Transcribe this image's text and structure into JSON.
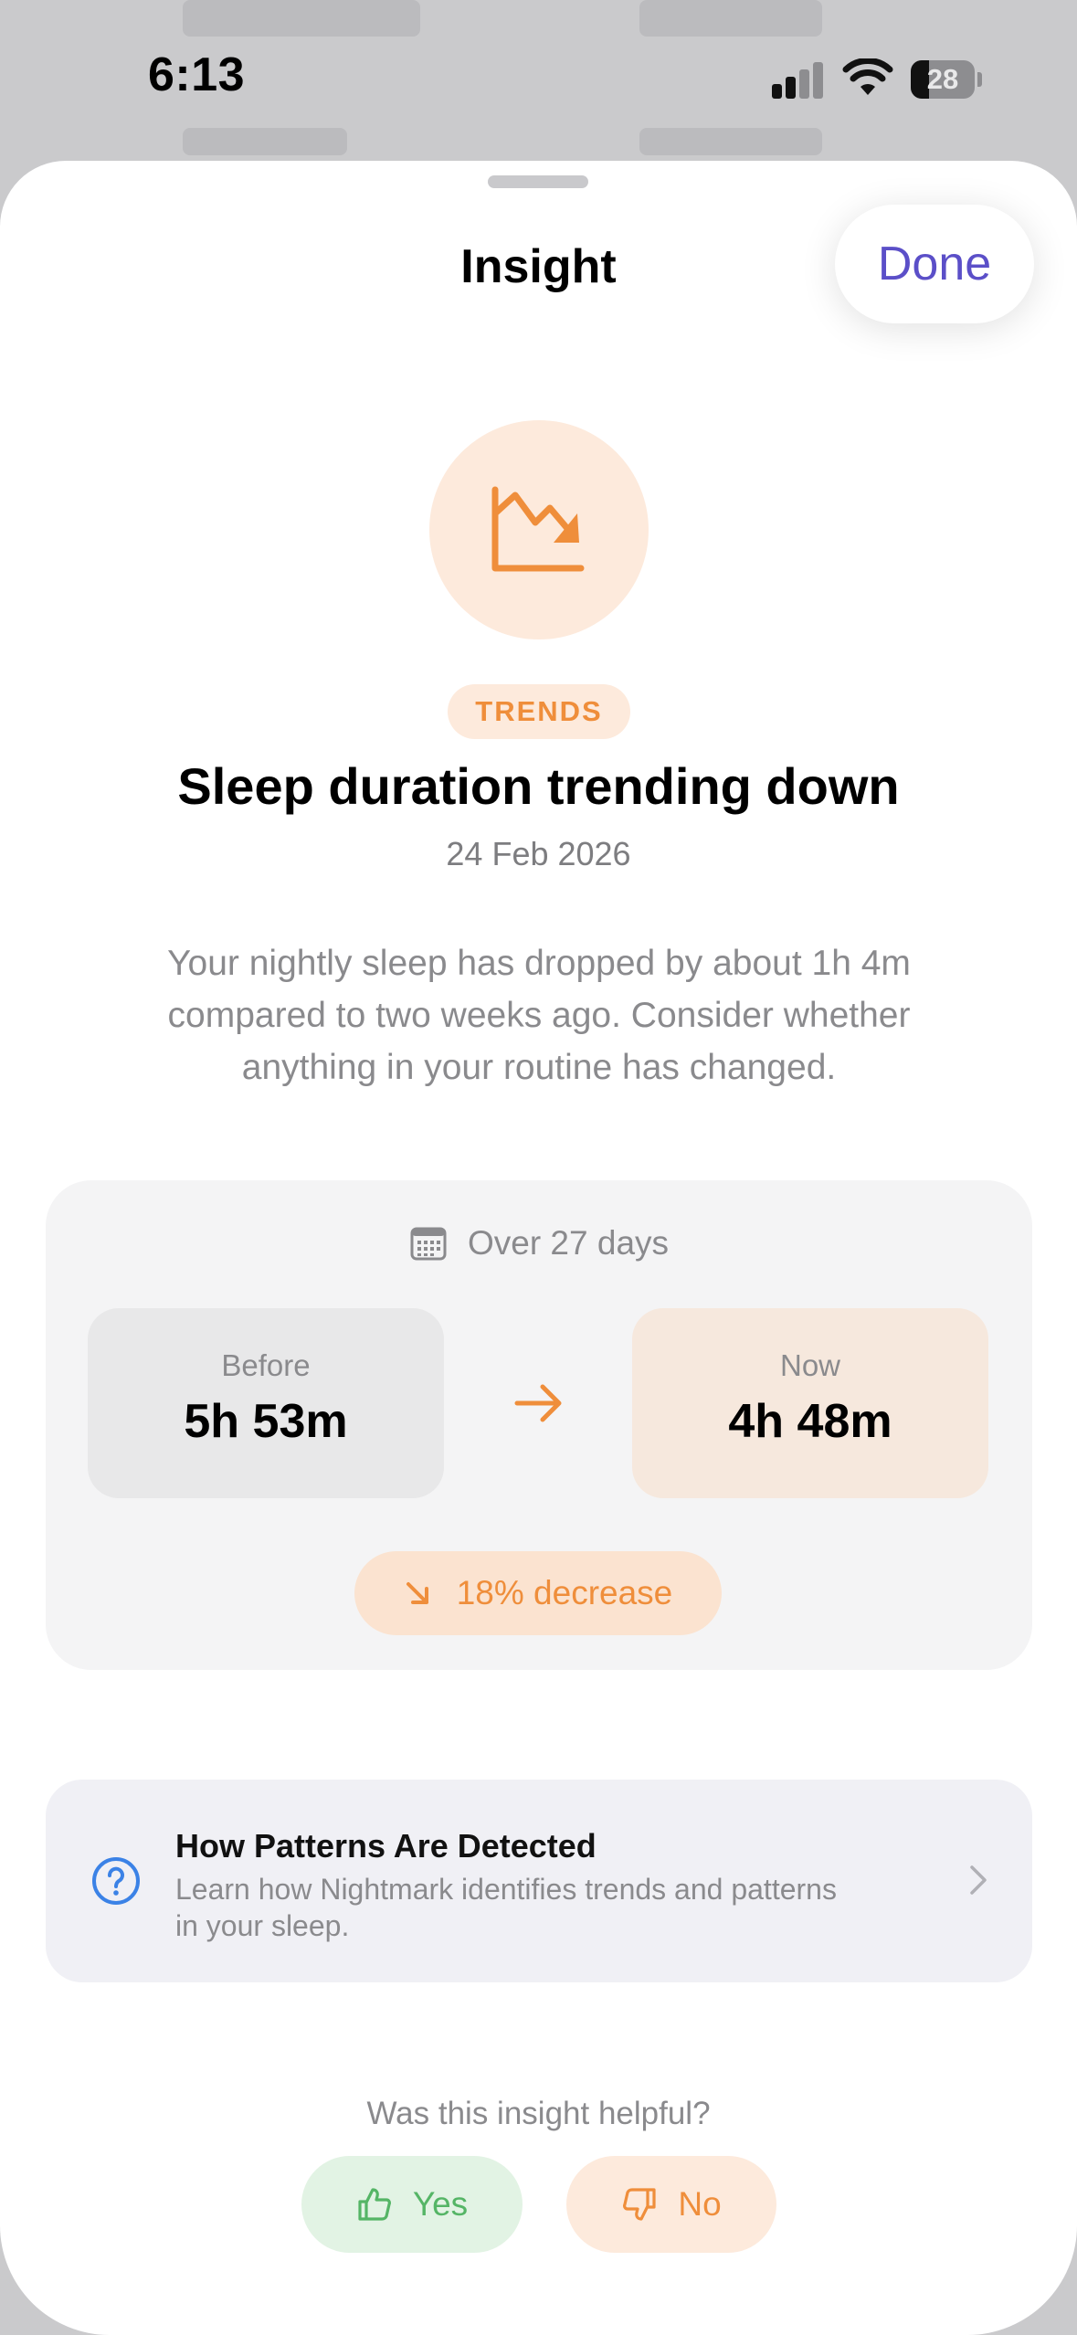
{
  "status_bar": {
    "time": "6:13",
    "battery_percent": "28",
    "battery_level": 0.28,
    "signal_icon": "cellular-signal-icon",
    "wifi_icon": "wifi-icon",
    "battery_icon": "battery-icon"
  },
  "sheet": {
    "title": "Insight",
    "done_label": "Done"
  },
  "insight": {
    "icon": "chart-trending-down-icon",
    "category": "TRENDS",
    "headline": "Sleep duration trending down",
    "date": "24 Feb 2026",
    "description": "Your nightly sleep has dropped by about 1h 4m compared to two weeks ago. Consider whether anything in your routine has changed."
  },
  "comparison": {
    "period_icon": "calendar-icon",
    "period_label": "Over 27 days",
    "before_label": "Before",
    "before_value": "5h 53m",
    "now_label": "Now",
    "now_value": "4h 48m",
    "arrow_icon": "arrow-right-icon",
    "change_icon": "arrow-down-right-icon",
    "change_label": "18% decrease"
  },
  "info": {
    "icon": "question-circle-icon",
    "title": "How Patterns Are Detected",
    "subtitle": "Learn how Nightmark identifies trends and patterns in your sleep.",
    "chevron_icon": "chevron-right-icon"
  },
  "feedback": {
    "question": "Was this insight helpful?",
    "yes_label": "Yes",
    "no_label": "No",
    "yes_icon": "thumbs-up-icon",
    "no_icon": "thumbs-down-icon"
  },
  "colors": {
    "accent_orange": "#ef8e3b",
    "done_purple": "#5b4fc8",
    "yes_green": "#55b566",
    "info_blue": "#3b82e6"
  }
}
